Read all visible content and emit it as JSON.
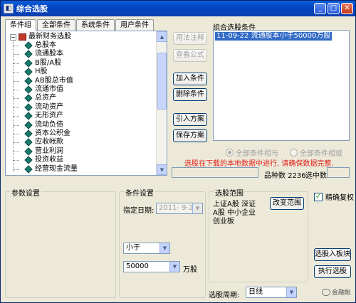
{
  "window": {
    "title": "综合选股",
    "icon": "app-icon"
  },
  "tabs": [
    "条件组",
    "全部条件",
    "系统条件",
    "用户条件"
  ],
  "tree": {
    "root": "最新财务选股",
    "items": [
      "总股本",
      "流通股本",
      "B股/A股",
      "H股",
      "AB股总市值",
      "流通市值",
      "总资产",
      "流动资产",
      "无形资产",
      "流动负债",
      "资本公积金",
      "应收帐款",
      "营业利润",
      "投资收益",
      "经营现金流量"
    ]
  },
  "actions": {
    "usage": "用法注释",
    "view_formula": "查看公式",
    "add": "加入条件",
    "delete": "删除条件",
    "import": "引入方案",
    "save": "保存方案"
  },
  "combined": {
    "label": "组合选股条件",
    "items": [
      "11-09-22  流通股本小于50000万股"
    ],
    "radio_all_hold": "全部条件相与",
    "radio_any_hold": "全部条件相或",
    "warning": "选股在下载的本地数据中进行, 请确保数据完整."
  },
  "stats": {
    "count_label": "品种数",
    "count_value": "2236",
    "selected_label": "选中数"
  },
  "param": {
    "label": "参数设置"
  },
  "cond": {
    "label": "条件设置",
    "date_label": "指定日期:",
    "date_value": "2011- 9-22",
    "op": "小于",
    "amount": "50000",
    "unit": "万股"
  },
  "range": {
    "label": "选股范围",
    "text_line1": "上证A股 深证",
    "text_line2": "A股 中小企业",
    "text_line3": "创业板",
    "change_btn": "改变范围"
  },
  "options": {
    "restore_label": "精确复权",
    "restore_checked": true
  },
  "period": {
    "label": "选股周期:",
    "value": "日线"
  },
  "bottom": {
    "to_block": "选股入板块",
    "execute": "执行选股"
  },
  "watermark": "金融帐"
}
